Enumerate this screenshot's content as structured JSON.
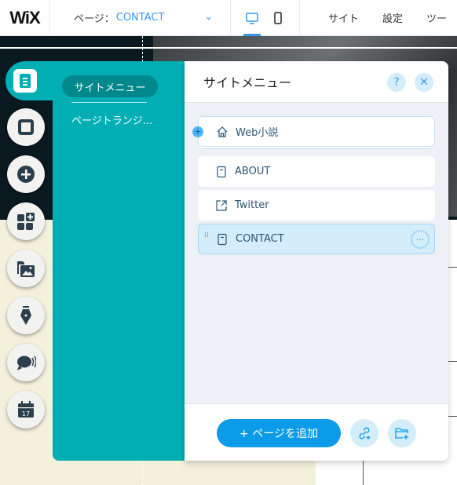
{
  "topbar": {
    "logo": "WiX",
    "page_label": "ページ：",
    "current_page": "CONTACT",
    "menu": [
      "サイト",
      "設定",
      "ツー"
    ]
  },
  "left_panel": {
    "tabs": [
      {
        "label": "サイトメニュー",
        "selected": true
      },
      {
        "label": "ページトランジ..."
      }
    ]
  },
  "site_menu": {
    "title": "サイトメニュー",
    "pages": [
      {
        "label": "Web小説",
        "icon": "home-icon",
        "home": true
      },
      {
        "label": "ABOUT",
        "icon": "page-icon"
      },
      {
        "label": "Twitter",
        "icon": "external-link-icon"
      },
      {
        "label": "CONTACT",
        "icon": "page-icon",
        "selected": true
      }
    ],
    "add_page_label": "+ ページを追加"
  },
  "colors": {
    "accent": "#3899ec",
    "panel_teal": "#00aeb4",
    "add_button": "#0c9be8"
  }
}
